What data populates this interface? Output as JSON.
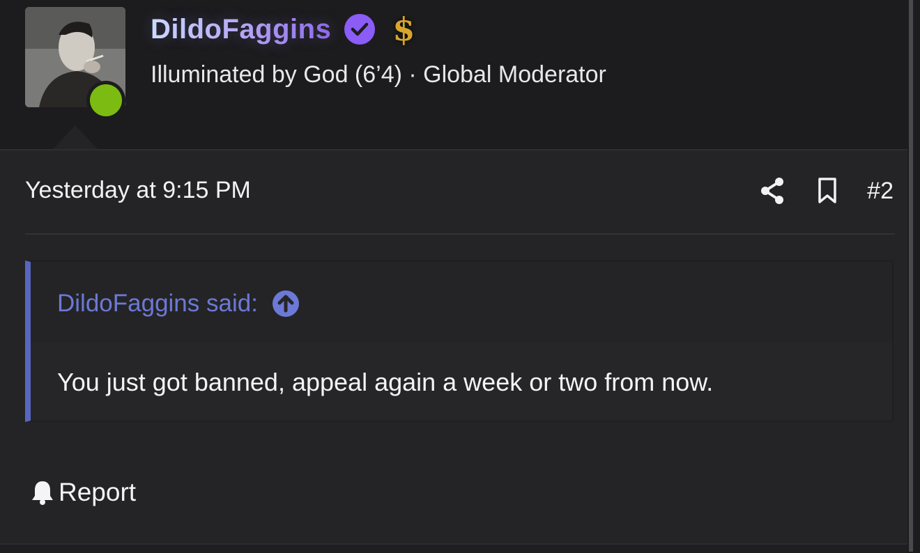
{
  "user": {
    "name": "DildoFaggins",
    "title": "Illuminated by God (6’4) · Global Moderator",
    "status": "online",
    "badge_icons": [
      "verified-check-icon",
      "dollar-icon"
    ],
    "dollar_glyph": "$"
  },
  "post": {
    "timestamp": "Yesterday at 9:15 PM",
    "number": "#2",
    "action_icons": [
      "share-icon",
      "bookmark-icon"
    ]
  },
  "quote": {
    "attribution": "DildoFaggins said:",
    "text": "You just got banned, appeal again a week or two from now."
  },
  "footer": {
    "report_label": "Report"
  },
  "colors": {
    "background": "#1c1c1e",
    "post_background": "#242426",
    "quote_accent": "#5866bf",
    "quote_author": "#6c79d6",
    "online": "#7cbc12",
    "verified": "#8b5cf6"
  }
}
